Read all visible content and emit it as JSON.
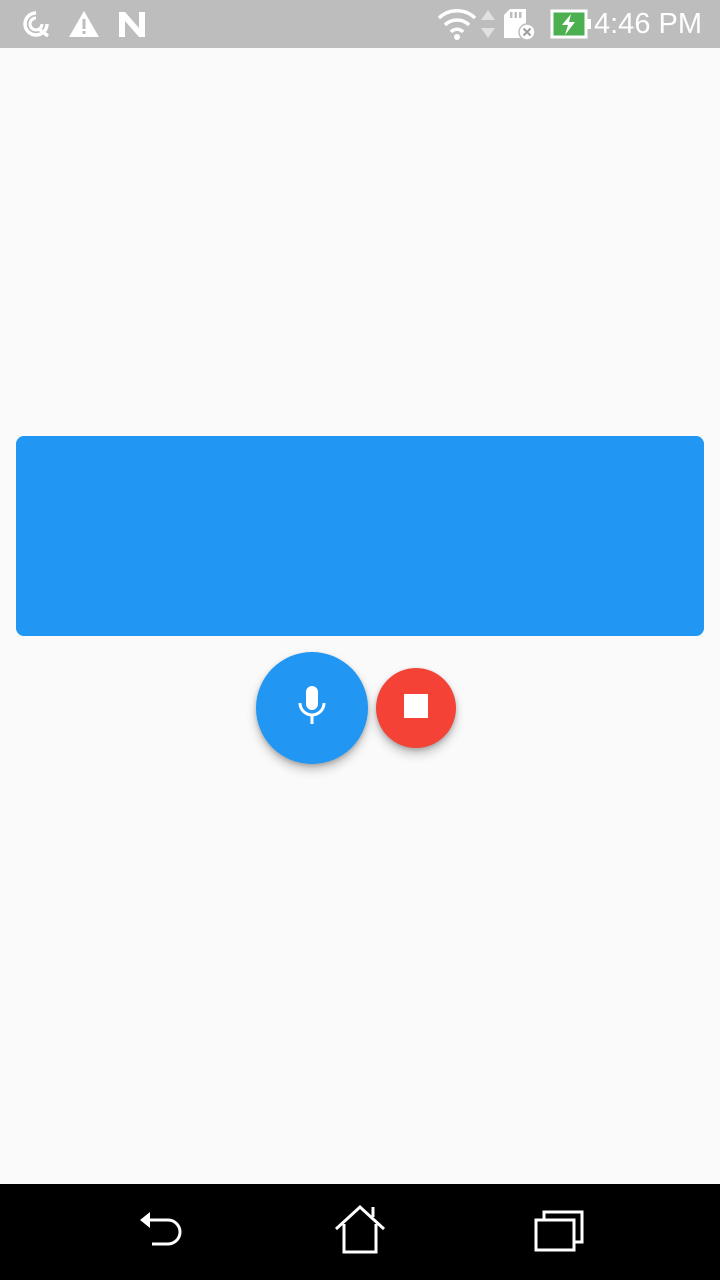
{
  "status_bar": {
    "time": "4:46 PM",
    "left_icons": [
      "data-saver-icon",
      "warning-icon",
      "n-icon"
    ],
    "right_icons": [
      "wifi-icon",
      "data-arrows-icon",
      "sd-card-icon",
      "battery-charging-icon"
    ],
    "color": "#BDBDBD"
  },
  "main": {
    "result_panel": {
      "text": "",
      "color": "#2196F3"
    },
    "mic_button": {
      "icon": "mic-icon",
      "color": "#2196F3"
    },
    "stop_button": {
      "icon": "stop-icon",
      "color": "#F44336"
    }
  },
  "nav_bar": {
    "buttons": [
      "back-icon",
      "home-icon",
      "recents-icon"
    ]
  }
}
